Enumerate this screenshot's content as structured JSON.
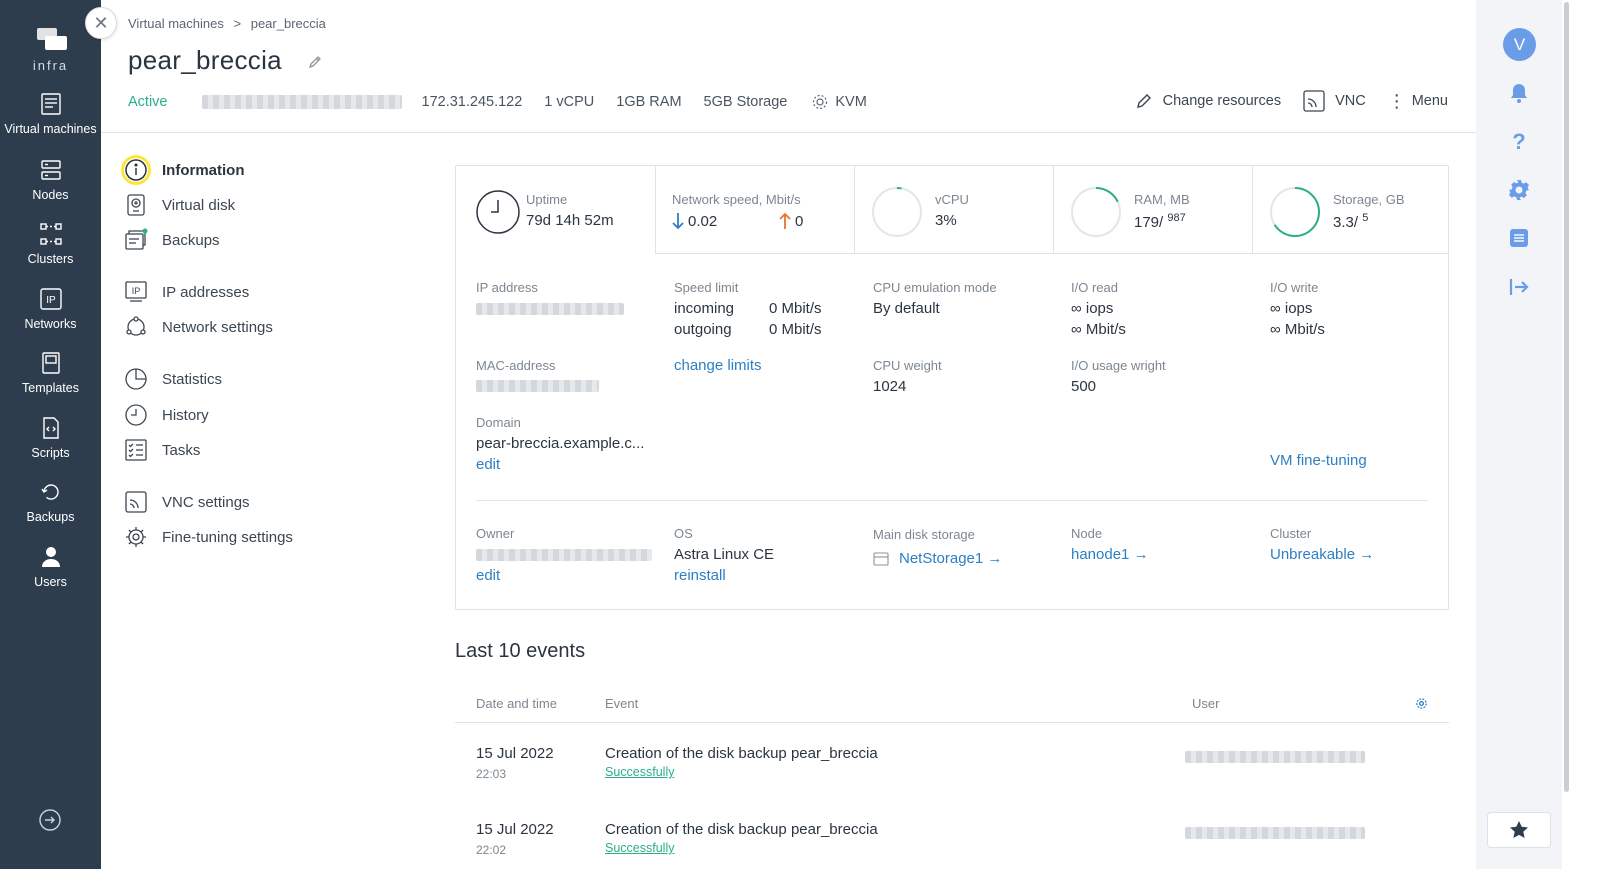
{
  "app": {
    "logo_text": "infra"
  },
  "nav": {
    "items": [
      {
        "label": "Virtual machines",
        "icon": "vm-icon"
      },
      {
        "label": "Nodes",
        "icon": "nodes-icon"
      },
      {
        "label": "Clusters",
        "icon": "clusters-icon"
      },
      {
        "label": "Networks",
        "icon": "networks-icon"
      },
      {
        "label": "Templates",
        "icon": "templates-icon"
      },
      {
        "label": "Scripts",
        "icon": "scripts-icon"
      },
      {
        "label": "Backups",
        "icon": "backups-icon"
      },
      {
        "label": "Users",
        "icon": "users-icon"
      }
    ]
  },
  "breadcrumb": {
    "parent": "Virtual machines",
    "separator": ">",
    "current": "pear_breccia"
  },
  "vm": {
    "name": "pear_breccia",
    "status": "Active",
    "ip": "172.31.245.122",
    "vcpu": "1 vCPU",
    "ram": "1GB RAM",
    "storage": "5GB Storage",
    "hypervisor": "KVM"
  },
  "actions": {
    "change_resources": "Change resources",
    "vnc": "VNC",
    "menu": "Menu"
  },
  "submenu": {
    "information": "Information",
    "virtual_disk": "Virtual disk",
    "backups": "Backups",
    "ip_addresses": "IP addresses",
    "network_settings": "Network settings",
    "statistics": "Statistics",
    "history": "History",
    "tasks": "Tasks",
    "vnc_settings": "VNC settings",
    "fine_tuning": "Fine-tuning settings"
  },
  "metrics": {
    "uptime": {
      "label": "Uptime",
      "value": "79d 14h 52m"
    },
    "network": {
      "label": "Network speed, Mbit/s",
      "down": "0.02",
      "up": "0"
    },
    "vcpu": {
      "label": "vCPU",
      "value": "3%",
      "fraction": 0.03
    },
    "ram": {
      "label": "RAM, MB",
      "used": "179",
      "total": "987",
      "fraction": 0.18
    },
    "storage": {
      "label": "Storage, GB",
      "used": "3.3",
      "total": "5",
      "fraction": 0.66
    }
  },
  "details": {
    "ip_label": "IP address",
    "speed_limit_label": "Speed limit",
    "incoming_label": "incoming",
    "incoming_value": "0 Mbit/s",
    "outgoing_label": "outgoing",
    "outgoing_value": "0 Mbit/s",
    "cpu_emulation_label": "CPU emulation mode",
    "cpu_emulation_value": "By default",
    "io_read_label": "I/O read",
    "io_read_iops": "∞ iops",
    "io_read_mbit": "∞ Mbit/s",
    "io_write_label": "I/O write",
    "io_write_iops": "∞ iops",
    "io_write_mbit": "∞ Mbit/s",
    "mac_label": "MAC-address",
    "change_limits": "change limits",
    "cpu_weight_label": "CPU weight",
    "cpu_weight_value": "1024",
    "io_usage_label": "I/O usage wright",
    "io_usage_value": "500",
    "domain_label": "Domain",
    "domain_value": "pear-breccia.example.c...",
    "domain_edit": "edit",
    "vm_fine_tuning": "VM fine-tuning",
    "owner_label": "Owner",
    "owner_edit": "edit",
    "os_label": "OS",
    "os_value": "Astra Linux CE",
    "os_reinstall": "reinstall",
    "disk_storage_label": "Main disk storage",
    "disk_storage_value": "NetStorage1 →",
    "node_label": "Node",
    "node_value": "hanode1 →",
    "cluster_label": "Cluster",
    "cluster_value": "Unbreakable →"
  },
  "events": {
    "title": "Last 10 events",
    "columns": {
      "date": "Date and time",
      "event": "Event",
      "user": "User"
    },
    "rows": [
      {
        "date": "15 Jul 2022",
        "time": "22:03",
        "event": "Creation of the disk backup pear_breccia",
        "status": "Successfully"
      },
      {
        "date": "15 Jul 2022",
        "time": "22:02",
        "event": "Creation of the disk backup pear_breccia",
        "status": "Successfully"
      }
    ]
  },
  "user": {
    "avatar_letter": "V"
  },
  "colors": {
    "nav_bg": "#2e3d4e",
    "accent_green": "#2bae8a",
    "link_blue": "#2d7fc3",
    "down_arrow": "#2d7fc3",
    "up_arrow": "#e8732e",
    "highlight": "#ffe43b",
    "avatar": "#6b9ce8"
  }
}
